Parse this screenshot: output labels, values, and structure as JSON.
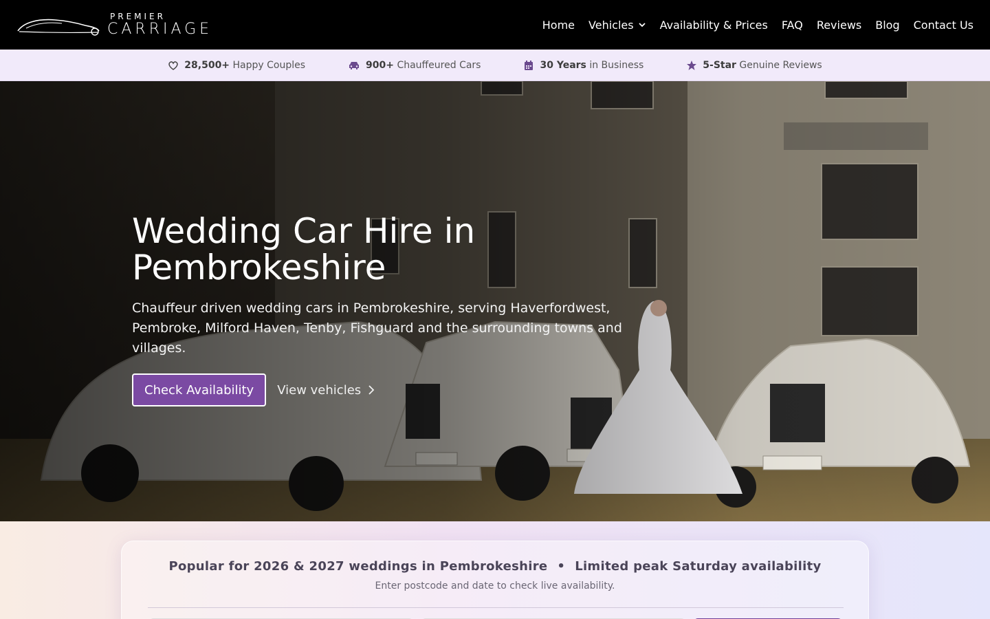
{
  "brand": {
    "small": "PREMIER",
    "big": "CARRIAGE"
  },
  "nav": [
    {
      "label": "Home"
    },
    {
      "label": "Vehicles",
      "has_dropdown": true
    },
    {
      "label": "Availability & Prices"
    },
    {
      "label": "FAQ"
    },
    {
      "label": "Reviews"
    },
    {
      "label": "Blog"
    },
    {
      "label": "Contact Us"
    }
  ],
  "stats": [
    {
      "icon": "heart-icon",
      "bold": "28,500+",
      "text": "Happy Couples"
    },
    {
      "icon": "car-icon",
      "bold": "900+",
      "text": "Chauffeured Cars"
    },
    {
      "icon": "calendar-icon",
      "bold": "30 Years",
      "text": "in Business"
    },
    {
      "icon": "star-icon",
      "bold": "5-Star",
      "text": "Genuine Reviews"
    }
  ],
  "hero": {
    "title_line1": "Wedding Car Hire in",
    "title_line2": "Pembrokeshire",
    "subtitle": "Chauffeur driven wedding cars in Pembrokeshire, serving Haverfordwest, Pembroke, Milford Haven, Tenby, Fishguard and the surrounding towns and villages.",
    "primary_cta": "Check Availability",
    "secondary_cta": "View vehicles"
  },
  "booking": {
    "headline_left": "Popular for 2026 & 2027 weddings in Pembrokeshire",
    "separator": "•",
    "headline_right": "Limited peak Saturday availability",
    "note": "Enter postcode and date to check live availability."
  },
  "colors": {
    "brand_purple": "#7b4aa3",
    "stats_bg": "#f1eafa",
    "stats_icon": "#6b4a8e"
  }
}
